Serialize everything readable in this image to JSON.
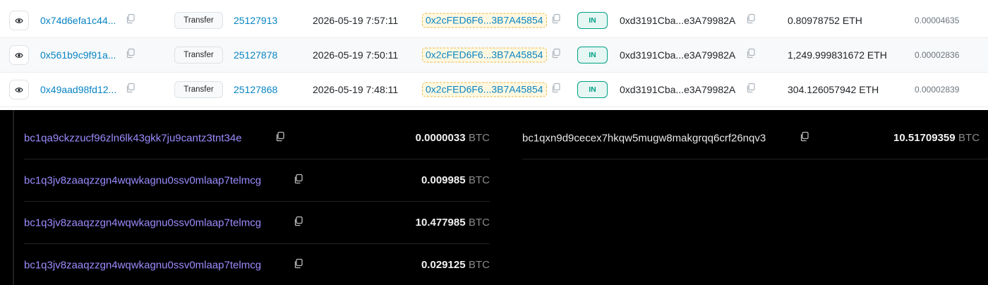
{
  "eth_table": {
    "rows": [
      {
        "tx_hash": "0x74d6efa1c44...",
        "method": "Transfer",
        "block": "25127913",
        "age": "2026-05-19 7:57:11",
        "from": "0x2cFED6F6...3B7A45854",
        "direction": "IN",
        "to": "0xd3191Cba...e3A79982A",
        "amount": "0.80978752 ETH",
        "fee": "0.00004635"
      },
      {
        "tx_hash": "0x561b9c9f91a...",
        "method": "Transfer",
        "block": "25127878",
        "age": "2026-05-19 7:50:11",
        "from": "0x2cFED6F6...3B7A45854",
        "direction": "IN",
        "to": "0xd3191Cba...e3A79982A",
        "amount": "1,249.999831672 ETH",
        "fee": "0.00002836"
      },
      {
        "tx_hash": "0x49aad98fd12...",
        "method": "Transfer",
        "block": "25127868",
        "age": "2026-05-19 7:48:11",
        "from": "0x2cFED6F6...3B7A45854",
        "direction": "IN",
        "to": "0xd3191Cba...e3A79982A",
        "amount": "304.126057942 ETH",
        "fee": "0.00002839"
      }
    ]
  },
  "btc_panel": {
    "unit": "BTC",
    "inputs": [
      {
        "address": "bc1qa9ckzzucf96zln6lk43gkk7ju9cantz3tnt34e",
        "value": "0.0000033"
      },
      {
        "address": "bc1q3jv8zaaqzzgn4wqwkagnu0ssv0mlaap7telmcg",
        "value": "0.009985"
      },
      {
        "address": "bc1q3jv8zaaqzzgn4wqwkagnu0ssv0mlaap7telmcg",
        "value": "10.477985"
      },
      {
        "address": "bc1q3jv8zaaqzzgn4wqwkagnu0ssv0mlaap7telmcg",
        "value": "0.029125"
      }
    ],
    "outputs": [
      {
        "address": "bc1qxn9d9cecex7hkqw5mugw8makgrqq6crf26nqv3",
        "value": "10.51709359"
      }
    ]
  },
  "icons": {
    "view": "eye-icon",
    "copy": "copy-icon"
  },
  "colors": {
    "link": "#0784c3",
    "in_badge": "#00a186",
    "highlight": "#e9b949",
    "btc_address": "#9b8cff"
  }
}
